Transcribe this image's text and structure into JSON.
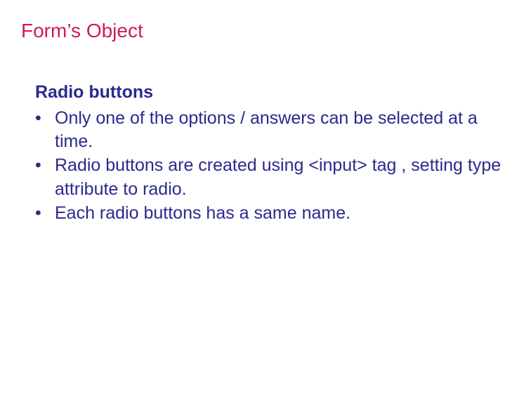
{
  "title": "Form’s Object",
  "subheading": "Radio buttons",
  "bullets": [
    "Only  one of the options / answers can be selected at a time.",
    "Radio buttons are created using <input> tag , setting type attribute to radio.",
    "Each radio buttons has a same name."
  ]
}
